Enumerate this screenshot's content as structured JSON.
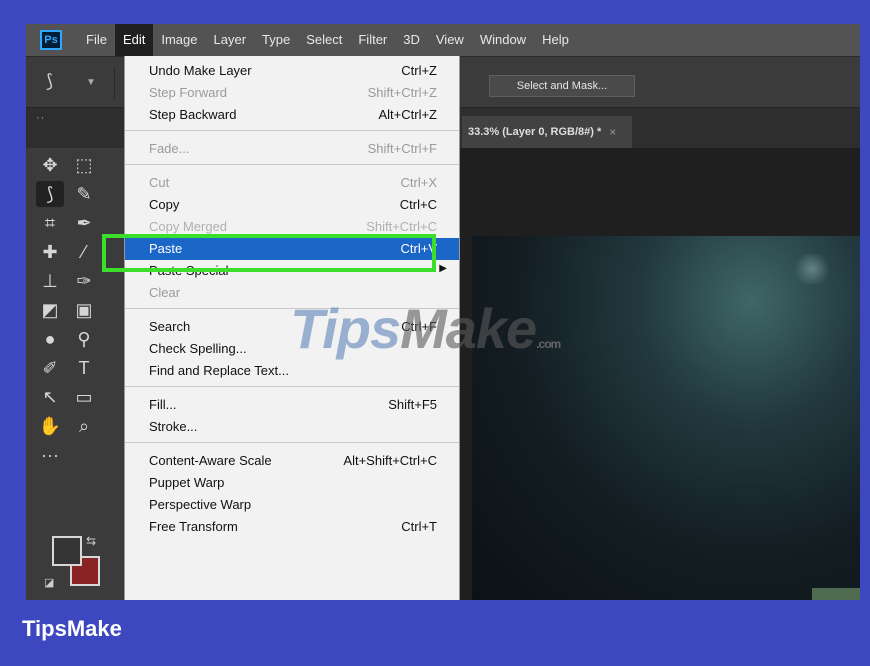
{
  "app": {
    "logo_text": "Ps"
  },
  "menubar": {
    "items": [
      "File",
      "Edit",
      "Image",
      "Layer",
      "Type",
      "Select",
      "Filter",
      "3D",
      "View",
      "Window",
      "Help"
    ],
    "active": "Edit"
  },
  "options": {
    "select_and_mask": "Select and Mask..."
  },
  "tabs": {
    "document": "33.3% (Layer 0, RGB/8#) *",
    "close_glyph": "×",
    "collapse": "··"
  },
  "edit_menu": {
    "groups": [
      [
        {
          "label": "Undo Make Layer",
          "shortcut": "Ctrl+Z",
          "state": "enabled"
        },
        {
          "label": "Step Forward",
          "shortcut": "Shift+Ctrl+Z",
          "state": "disabled"
        },
        {
          "label": "Step Backward",
          "shortcut": "Alt+Ctrl+Z",
          "state": "enabled"
        }
      ],
      [
        {
          "label": "Fade...",
          "shortcut": "Shift+Ctrl+F",
          "state": "disabled"
        }
      ],
      [
        {
          "label": "Cut",
          "shortcut": "Ctrl+X",
          "state": "disabled"
        },
        {
          "label": "Copy",
          "shortcut": "Ctrl+C",
          "state": "enabled"
        },
        {
          "label": "Copy Merged",
          "shortcut": "Shift+Ctrl+C",
          "state": "disabled"
        },
        {
          "label": "Paste",
          "shortcut": "Ctrl+V",
          "state": "highlighted"
        },
        {
          "label": "Paste Special",
          "shortcut": "",
          "state": "enabled",
          "submenu": true
        },
        {
          "label": "Clear",
          "shortcut": "",
          "state": "disabled"
        }
      ],
      [
        {
          "label": "Search",
          "shortcut": "Ctrl+F",
          "state": "enabled"
        },
        {
          "label": "Check Spelling...",
          "shortcut": "",
          "state": "enabled"
        },
        {
          "label": "Find and Replace Text...",
          "shortcut": "",
          "state": "enabled"
        }
      ],
      [
        {
          "label": "Fill...",
          "shortcut": "Shift+F5",
          "state": "enabled"
        },
        {
          "label": "Stroke...",
          "shortcut": "",
          "state": "enabled"
        }
      ],
      [
        {
          "label": "Content-Aware Scale",
          "shortcut": "Alt+Shift+Ctrl+C",
          "state": "enabled"
        },
        {
          "label": "Puppet Warp",
          "shortcut": "",
          "state": "enabled"
        },
        {
          "label": "Perspective Warp",
          "shortcut": "",
          "state": "enabled"
        },
        {
          "label": "Free Transform",
          "shortcut": "Ctrl+T",
          "state": "enabled"
        }
      ]
    ]
  },
  "tools": [
    {
      "name": "move-tool-icon",
      "glyph": "✥"
    },
    {
      "name": "marquee-tool-icon",
      "glyph": "⬚"
    },
    {
      "name": "lasso-tool-icon",
      "glyph": "⟆",
      "selected": true
    },
    {
      "name": "quick-select-tool-icon",
      "glyph": "✎"
    },
    {
      "name": "crop-tool-icon",
      "glyph": "⌗"
    },
    {
      "name": "eyedropper-tool-icon",
      "glyph": "✒"
    },
    {
      "name": "healing-brush-tool-icon",
      "glyph": "✚"
    },
    {
      "name": "brush-tool-icon",
      "glyph": "⁄"
    },
    {
      "name": "stamp-tool-icon",
      "glyph": "⊥"
    },
    {
      "name": "history-brush-tool-icon",
      "glyph": "✑"
    },
    {
      "name": "eraser-tool-icon",
      "glyph": "◩"
    },
    {
      "name": "gradient-tool-icon",
      "glyph": "▣"
    },
    {
      "name": "blur-tool-icon",
      "glyph": "●"
    },
    {
      "name": "dodge-tool-icon",
      "glyph": "⚲"
    },
    {
      "name": "pen-tool-icon",
      "glyph": "✐"
    },
    {
      "name": "type-tool-icon",
      "glyph": "T"
    },
    {
      "name": "path-select-tool-icon",
      "glyph": "↖"
    },
    {
      "name": "shape-tool-icon",
      "glyph": "▭"
    },
    {
      "name": "hand-tool-icon",
      "glyph": "✋"
    },
    {
      "name": "zoom-tool-icon",
      "glyph": "⌕"
    },
    {
      "name": "more-tools-icon",
      "glyph": "···"
    }
  ],
  "watermark": {
    "main": "Tips",
    "tail": "Make",
    "suffix": ".com"
  },
  "footer": {
    "brand": "TipsMake"
  },
  "colors": {
    "accent": "#3c47c0",
    "highlight": "#1a67c8",
    "callout": "#3cde2c",
    "background_swatch": "#8a2424"
  }
}
